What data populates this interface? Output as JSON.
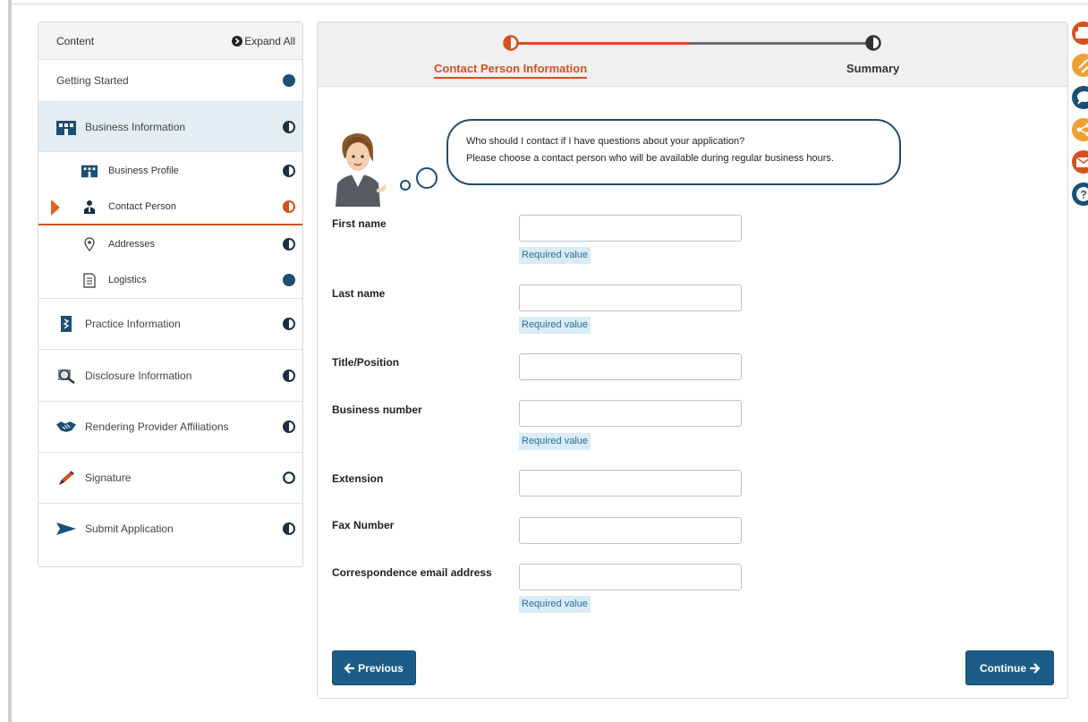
{
  "sidebar": {
    "header_title": "Content",
    "expand_all": "Expand All",
    "sections": [
      {
        "label": "Getting Started",
        "status": "complete"
      },
      {
        "label": "Business Information",
        "status": "partial"
      },
      {
        "label": "Practice Information",
        "status": "partial"
      },
      {
        "label": "Disclosure Information",
        "status": "partial"
      },
      {
        "label": "Rendering Provider Affiliations",
        "status": "partial"
      },
      {
        "label": "Signature",
        "status": "empty"
      },
      {
        "label": "Submit Application",
        "status": "partial"
      }
    ],
    "sub_items": [
      {
        "label": "Business Profile",
        "status": "partial"
      },
      {
        "label": "Contact Person",
        "status": "active"
      },
      {
        "label": "Addresses",
        "status": "partial"
      },
      {
        "label": "Logistics",
        "status": "complete"
      }
    ]
  },
  "steps": {
    "step1": "Contact Person Information",
    "step2": "Summary"
  },
  "bubble": {
    "line1": "Who should I contact if I have questions about your application?",
    "line2": "Please choose a contact person who will be available during regular business hours."
  },
  "form": {
    "first_name": {
      "label": "First name",
      "value": "",
      "hint": "Required value"
    },
    "last_name": {
      "label": "Last name",
      "value": "",
      "hint": "Required value"
    },
    "title": {
      "label": "Title/Position",
      "value": ""
    },
    "business_number": {
      "label": "Business number",
      "value": "",
      "hint": "Required value"
    },
    "extension": {
      "label": "Extension",
      "value": ""
    },
    "fax": {
      "label": "Fax Number",
      "value": ""
    },
    "email": {
      "label": "Correspondence email address",
      "value": "",
      "hint": "Required value"
    }
  },
  "buttons": {
    "previous": "Previous",
    "continue": "Continue"
  },
  "colors": {
    "primary": "#1b5d86",
    "accent": "#d4511e",
    "hint_bg": "#d9ecf7"
  },
  "right_toolbar_icons": [
    "print-icon",
    "attachment-icon",
    "chat-icon",
    "share-icon",
    "mail-icon",
    "help-icon"
  ]
}
